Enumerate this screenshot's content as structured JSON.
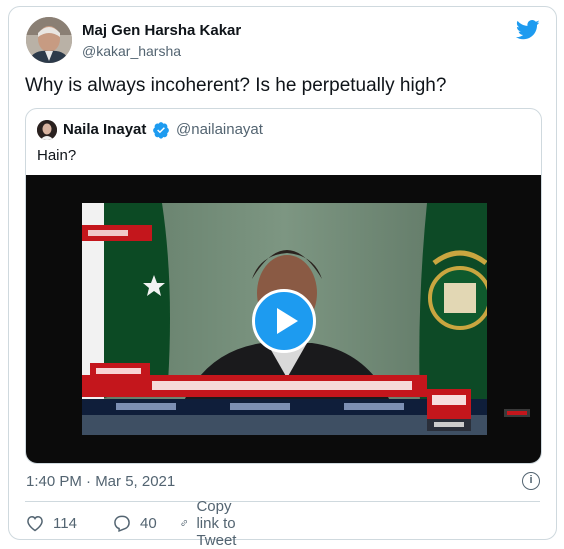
{
  "tweet": {
    "author_name": "Maj Gen Harsha Kakar",
    "author_handle": "@kakar_harsha",
    "text": "Why is always incoherent? Is he perpetually high?",
    "timestamp": "1:40 PM · Mar 5, 2021",
    "likes": "114",
    "replies": "40",
    "copy_link_label": "Copy link to Tweet"
  },
  "quote": {
    "author_name": "Naila Inayat",
    "author_handle": "@nailainayat",
    "text": "Hain?"
  },
  "colors": {
    "accent": "#1d9bf0",
    "border": "#cfd9de",
    "muted_text": "#536471",
    "ticker_red": "#c4161c"
  },
  "icons": [
    "twitter-bird-icon",
    "verified-badge-icon",
    "play-icon",
    "info-icon",
    "heart-icon",
    "reply-icon",
    "link-icon"
  ]
}
